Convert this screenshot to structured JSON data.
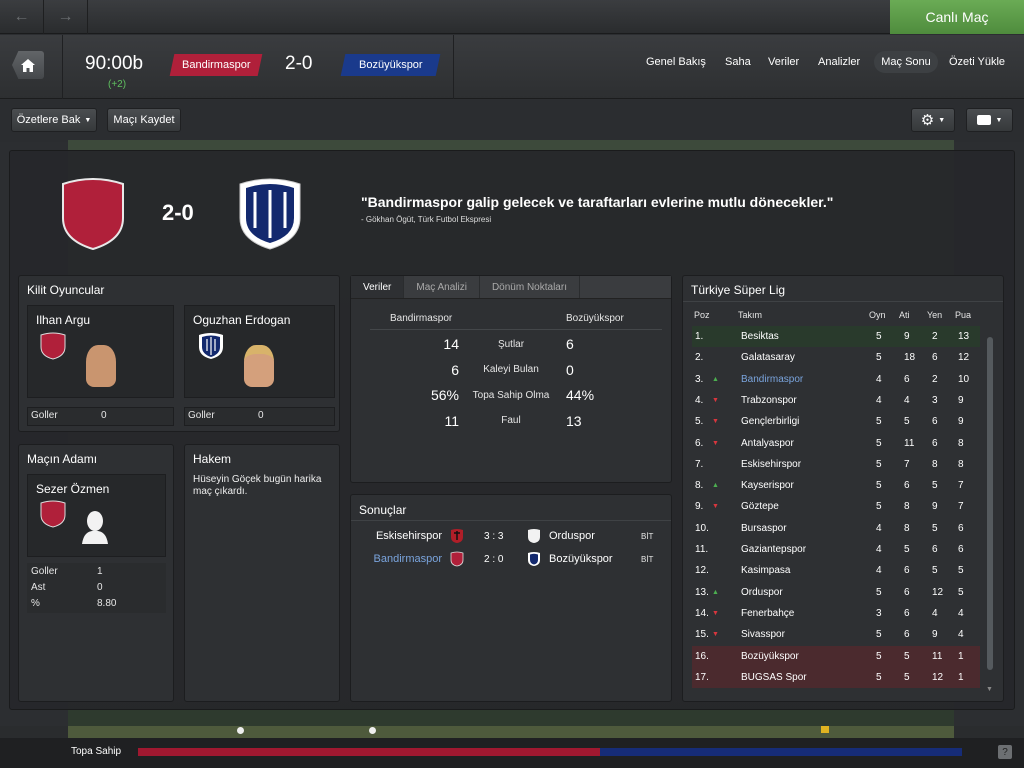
{
  "live_match_label": "Canlı Maç",
  "header": {
    "time": "90:00b",
    "added_time": "(+2)",
    "home_team": "Bandirmaspor",
    "away_team": "Bozüyükspor",
    "score": "2-0",
    "menu": [
      "Genel Bakış",
      "Saha",
      "Veriler",
      "Analizler",
      "Maç Sonu",
      "Özeti Yükle"
    ]
  },
  "toolbar": {
    "highlights_label": "Özetlere Bak",
    "save_label": "Maçı Kaydet"
  },
  "hero": {
    "score": "2-0",
    "quote": "\"Bandirmaspor galip gelecek ve taraftarları evlerine mutlu dönecekler.\"",
    "source": "- Gökhan Ögüt, Türk Futbol Ekspresi"
  },
  "key_players": {
    "title": "Kilit Oyuncular",
    "players": [
      {
        "name": "Ilhan Argu",
        "stat_label": "Goller",
        "stat_value": "0"
      },
      {
        "name": "Oguzhan Erdogan",
        "stat_label": "Goller",
        "stat_value": "0"
      }
    ]
  },
  "man_of_match": {
    "title": "Maçın Adamı",
    "name": "Sezer Özmen",
    "stats": [
      {
        "label": "Goller",
        "value": "1"
      },
      {
        "label": "Ast",
        "value": "0"
      },
      {
        "label": "%",
        "value": "8.80"
      }
    ]
  },
  "referee": {
    "title": "Hakem",
    "text": "Hüseyin Göçek bugün harika maç çıkardı."
  },
  "stats_panel": {
    "tabs": [
      "Veriler",
      "Maç Analizi",
      "Dönüm Noktaları"
    ],
    "home": "Bandirmaspor",
    "away": "Bozüyükspor",
    "rows": [
      {
        "home": "14",
        "label": "Şutlar",
        "away": "6"
      },
      {
        "home": "6",
        "label": "Kaleyi Bulan",
        "away": "0"
      },
      {
        "home": "56%",
        "label": "Topa Sahip Olma",
        "away": "44%"
      },
      {
        "home": "11",
        "label": "Faul",
        "away": "13"
      }
    ]
  },
  "results": {
    "title": "Sonuçlar",
    "rows": [
      {
        "home": "Eskisehirspor",
        "score": "3 : 3",
        "away": "Orduspor",
        "status": "BİT"
      },
      {
        "home": "Bandirmaspor",
        "score": "2 : 0",
        "away": "Bozüyükspor",
        "status": "BİT"
      }
    ]
  },
  "league": {
    "title": "Türkiye Süper Lig",
    "headers": [
      "Poz",
      "Takım",
      "Oyn",
      "Ati",
      "Yen",
      "Pua"
    ],
    "rows": [
      {
        "pos": "1.",
        "team": "Besiktas",
        "p": "5",
        "a": "9",
        "y": "2",
        "pts": "13",
        "arrow": "",
        "zone": "champ"
      },
      {
        "pos": "2.",
        "team": "Galatasaray",
        "p": "5",
        "a": "18",
        "y": "6",
        "pts": "12",
        "arrow": "",
        "zone": ""
      },
      {
        "pos": "3.",
        "team": "Bandirmaspor",
        "p": "4",
        "a": "6",
        "y": "2",
        "pts": "10",
        "arrow": "up",
        "zone": ""
      },
      {
        "pos": "4.",
        "team": "Trabzonspor",
        "p": "4",
        "a": "4",
        "y": "3",
        "pts": "9",
        "arrow": "down",
        "zone": ""
      },
      {
        "pos": "5.",
        "team": "Gençlerbirligi",
        "p": "5",
        "a": "5",
        "y": "6",
        "pts": "9",
        "arrow": "down",
        "zone": ""
      },
      {
        "pos": "6.",
        "team": "Antalyaspor",
        "p": "5",
        "a": "11",
        "y": "6",
        "pts": "8",
        "arrow": "down",
        "zone": ""
      },
      {
        "pos": "7.",
        "team": "Eskisehirspor",
        "p": "5",
        "a": "7",
        "y": "8",
        "pts": "8",
        "arrow": "",
        "zone": ""
      },
      {
        "pos": "8.",
        "team": "Kayserispor",
        "p": "5",
        "a": "6",
        "y": "5",
        "pts": "7",
        "arrow": "up",
        "zone": ""
      },
      {
        "pos": "9.",
        "team": "Göztepe",
        "p": "5",
        "a": "8",
        "y": "9",
        "pts": "7",
        "arrow": "down",
        "zone": ""
      },
      {
        "pos": "10.",
        "team": "Bursaspor",
        "p": "4",
        "a": "8",
        "y": "5",
        "pts": "6",
        "arrow": "",
        "zone": ""
      },
      {
        "pos": "11.",
        "team": "Gaziantepspor",
        "p": "4",
        "a": "5",
        "y": "6",
        "pts": "6",
        "arrow": "",
        "zone": ""
      },
      {
        "pos": "12.",
        "team": "Kasimpasa",
        "p": "4",
        "a": "6",
        "y": "5",
        "pts": "5",
        "arrow": "",
        "zone": ""
      },
      {
        "pos": "13.",
        "team": "Orduspor",
        "p": "5",
        "a": "6",
        "y": "12",
        "pts": "5",
        "arrow": "up",
        "zone": ""
      },
      {
        "pos": "14.",
        "team": "Fenerbahçe",
        "p": "3",
        "a": "6",
        "y": "4",
        "pts": "4",
        "arrow": "down",
        "zone": ""
      },
      {
        "pos": "15.",
        "team": "Sivasspor",
        "p": "5",
        "a": "6",
        "y": "9",
        "pts": "4",
        "arrow": "down",
        "zone": ""
      },
      {
        "pos": "16.",
        "team": "Bozüyükspor",
        "p": "5",
        "a": "5",
        "y": "11",
        "pts": "1",
        "arrow": "",
        "zone": "rel"
      },
      {
        "pos": "17.",
        "team": "BUGSAS Spor",
        "p": "5",
        "a": "5",
        "y": "12",
        "pts": "1",
        "arrow": "",
        "zone": "rel"
      }
    ]
  },
  "bottom": {
    "possession_label": "Topa Sahip",
    "help": "?"
  },
  "colors": {
    "home": "#b0203a",
    "away": "#1a3a8c",
    "highlight": "#7aa4dd",
    "live": "#5c9c48",
    "up": "#4caf50",
    "down": "#d9363e"
  }
}
